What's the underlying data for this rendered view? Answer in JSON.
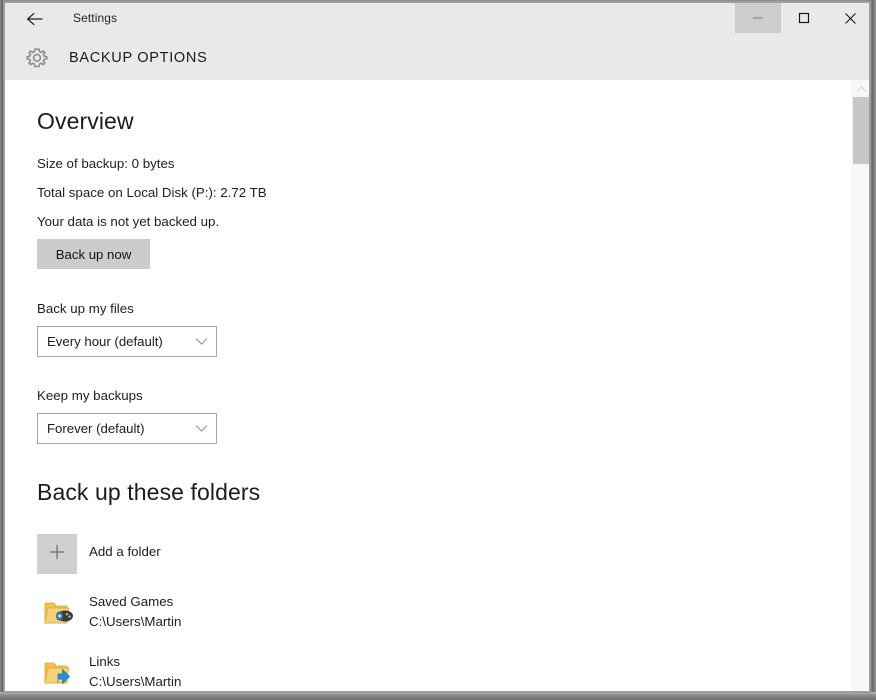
{
  "window": {
    "app_title": "Settings",
    "back_icon": "back-arrow-icon",
    "controls": {
      "minimize_label": "─",
      "maximize_label": "☐",
      "close_label": "✕"
    }
  },
  "header": {
    "icon": "gear-icon",
    "title": "BACKUP OPTIONS"
  },
  "overview": {
    "heading": "Overview",
    "size_of_backup": "Size of backup: 0 bytes",
    "total_space": "Total space on Local Disk (P:): 2.72 TB",
    "backup_state": "Your data is not yet backed up.",
    "backup_now_label": "Back up now"
  },
  "settings": {
    "frequency": {
      "label": "Back up my files",
      "value": "Every hour (default)",
      "chevron_icon": "chevron-down-icon"
    },
    "retention": {
      "label": "Keep my backups",
      "value": "Forever (default)",
      "chevron_icon": "chevron-down-icon"
    }
  },
  "folders": {
    "heading": "Back up these folders",
    "add_label": "Add a folder",
    "add_icon": "plus-icon",
    "items": [
      {
        "name": "Saved Games",
        "path": "C:\\Users\\Martin",
        "icon": "folder-saved-games-icon"
      },
      {
        "name": "Links",
        "path": "C:\\Users\\Martin",
        "icon": "folder-links-icon"
      }
    ]
  },
  "scrollbar": {
    "up_icon": "scroll-up-arrow-icon",
    "down_icon": "scroll-down-arrow-icon"
  },
  "colors": {
    "chrome": "#e9e9e9",
    "content": "#ffffff",
    "button_gray": "#cccccc",
    "border_gray": "#a6a6a6",
    "text": "#1d1d1d",
    "folder_yellow": "#f2c14b",
    "link_blue": "#2d8fd8"
  }
}
